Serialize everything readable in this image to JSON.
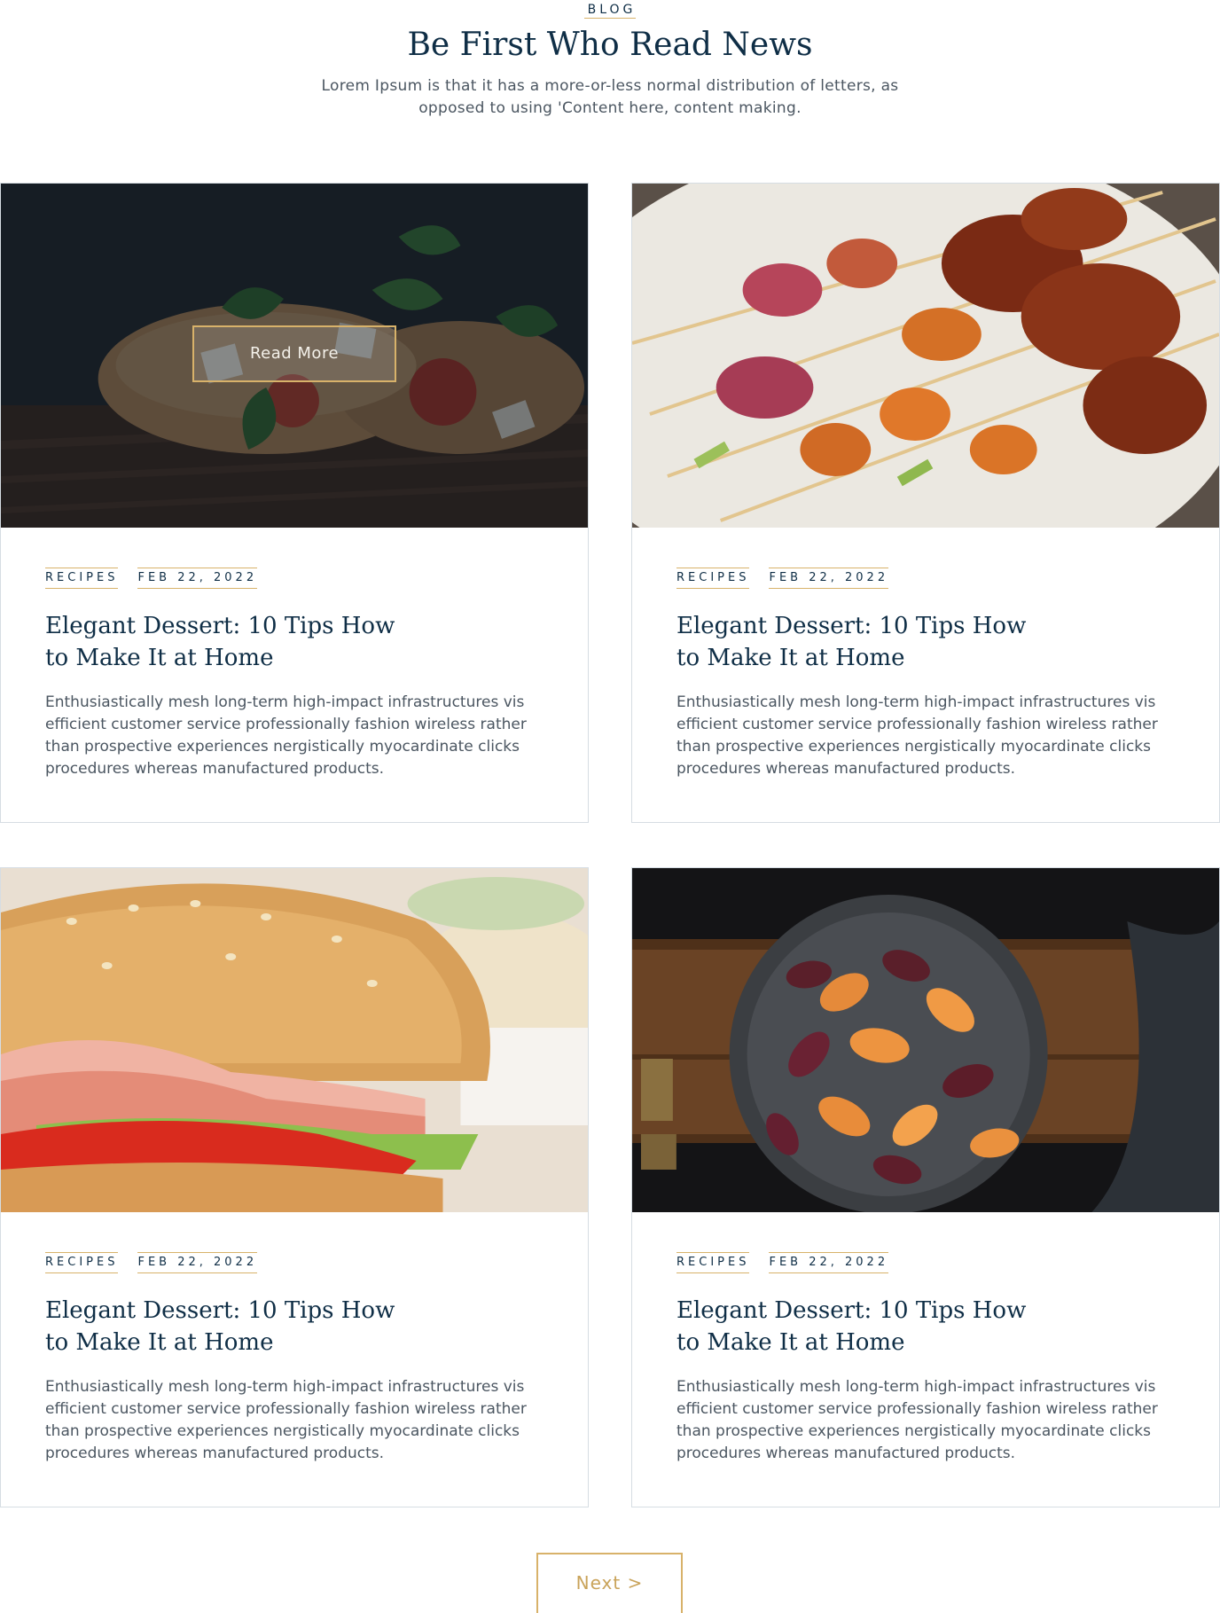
{
  "header": {
    "eyebrow": "BLOG",
    "title": "Be First Who Read News",
    "intro": "Lorem Ipsum is that it has a more-or-less normal distribution of letters, as opposed to using 'Content here, content making."
  },
  "posts": [
    {
      "category": "RECIPES",
      "date": "FEB 22, 2022",
      "title": "Elegant Dessert: 10 Tips How to Make It at Home",
      "excerpt": "Enthusiastically mesh long-term high-impact infrastructures vis efficient customer service professionally fashion wireless rather than prospective experiences nergistically myocardinate clicks procedures whereas manufactured products.",
      "image": "bruschetta-photo",
      "hover_button": "Read More"
    },
    {
      "category": "RECIPES",
      "date": "FEB 22, 2022",
      "title": "Elegant Dessert: 10 Tips How to Make It at Home",
      "excerpt": "Enthusiastically mesh long-term high-impact infrastructures vis efficient customer service professionally fashion wireless rather than prospective experiences nergistically myocardinate clicks procedures whereas manufactured products.",
      "image": "grilled-skewers-photo"
    },
    {
      "category": "RECIPES",
      "date": "FEB 22, 2022",
      "title": "Elegant Dessert: 10 Tips How to Make It at Home",
      "excerpt": "Enthusiastically mesh long-term high-impact infrastructures vis efficient customer service professionally fashion wireless rather than prospective experiences nergistically myocardinate clicks procedures whereas manufactured products.",
      "image": "ham-sandwich-photo"
    },
    {
      "category": "RECIPES",
      "date": "FEB 22, 2022",
      "title": "Elegant Dessert: 10 Tips How to Make It at Home",
      "excerpt": "Enthusiastically mesh long-term high-impact infrastructures vis efficient customer service professionally fashion wireless rather than prospective experiences nergistically myocardinate clicks procedures whereas manufactured products.",
      "image": "roasted-plums-photo"
    }
  ],
  "pagination": {
    "next_label": "Next >"
  },
  "colors": {
    "navy": "#0f2e46",
    "gold": "#d8b26a",
    "body_text": "#4b5661",
    "border": "#d6dde3"
  }
}
